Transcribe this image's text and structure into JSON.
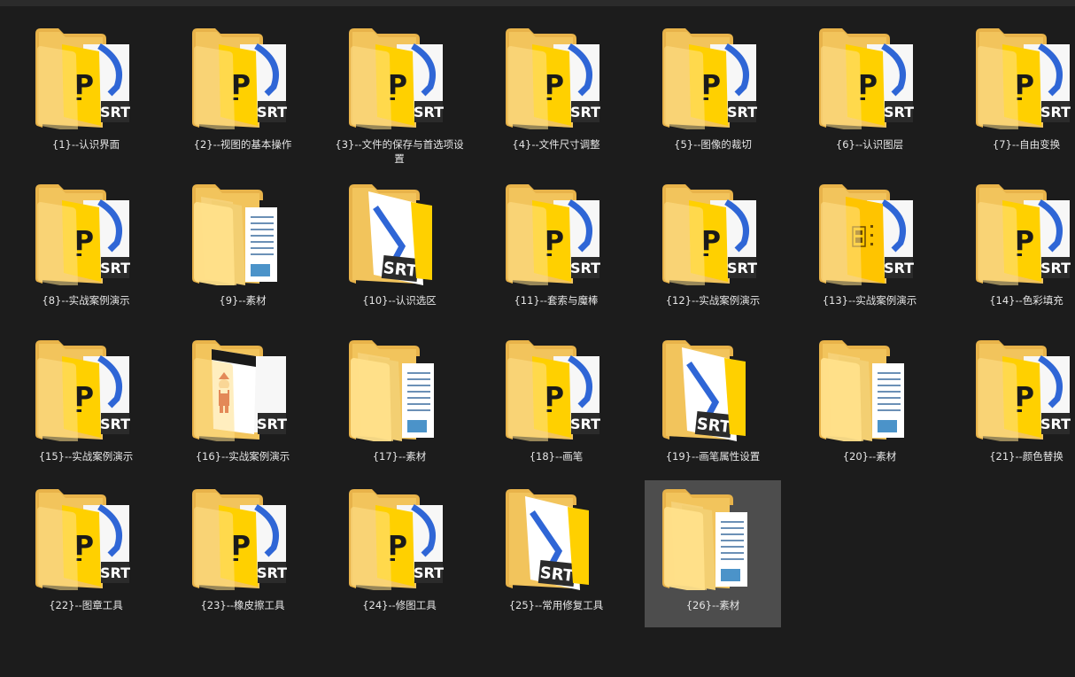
{
  "items": [
    {
      "label": "{1}--认识界面",
      "preview": "ps"
    },
    {
      "label": "{2}--视图的基本操作",
      "preview": "ps"
    },
    {
      "label": "{3}--文件的保存与首选项设置",
      "preview": "ps"
    },
    {
      "label": "{4}--文件尺寸调整",
      "preview": "ps"
    },
    {
      "label": "{5}--图像的裁切",
      "preview": "ps"
    },
    {
      "label": "{6}--认识图层",
      "preview": "ps"
    },
    {
      "label": "{7}--自由变换",
      "preview": "ps"
    },
    {
      "label": "{8}--实战案例演示",
      "preview": "ps"
    },
    {
      "label": "{9}--素材",
      "preview": "doc"
    },
    {
      "label": "{10}--认识选区",
      "preview": "srt"
    },
    {
      "label": "{11}--套索与魔棒",
      "preview": "ps"
    },
    {
      "label": "{12}--实战案例演示",
      "preview": "ps"
    },
    {
      "label": "{13}--实战案例演示",
      "preview": "qr"
    },
    {
      "label": "{14}--色彩填充",
      "preview": "ps"
    },
    {
      "label": "{15}--实战案例演示",
      "preview": "ps"
    },
    {
      "label": "{16}--实战案例演示",
      "preview": "santa"
    },
    {
      "label": "{17}--素材",
      "preview": "doc"
    },
    {
      "label": "{18}--画笔",
      "preview": "ps"
    },
    {
      "label": "{19}--画笔属性设置",
      "preview": "srt"
    },
    {
      "label": "{20}--素材",
      "preview": "doc"
    },
    {
      "label": "{21}--颜色替换",
      "preview": "ps"
    },
    {
      "label": "{22}--图章工具",
      "preview": "ps"
    },
    {
      "label": "{23}--橡皮擦工具",
      "preview": "ps"
    },
    {
      "label": "{24}--修图工具",
      "preview": "ps"
    },
    {
      "label": "{25}--常用修复工具",
      "preview": "srt"
    },
    {
      "label": "{26}--素材",
      "preview": "doc",
      "selected": true
    }
  ],
  "icon_text": {
    "srt": "SRT",
    "ps_letter": "P"
  },
  "colors": {
    "background": "#1c1c1c",
    "selection": "#4d4d4d",
    "folder_back": "#f0c15a",
    "folder_front": "#ffd766",
    "yellow_page": "#ffd000",
    "accent_blue": "#2f66d6",
    "text": "#e6e6e6"
  }
}
